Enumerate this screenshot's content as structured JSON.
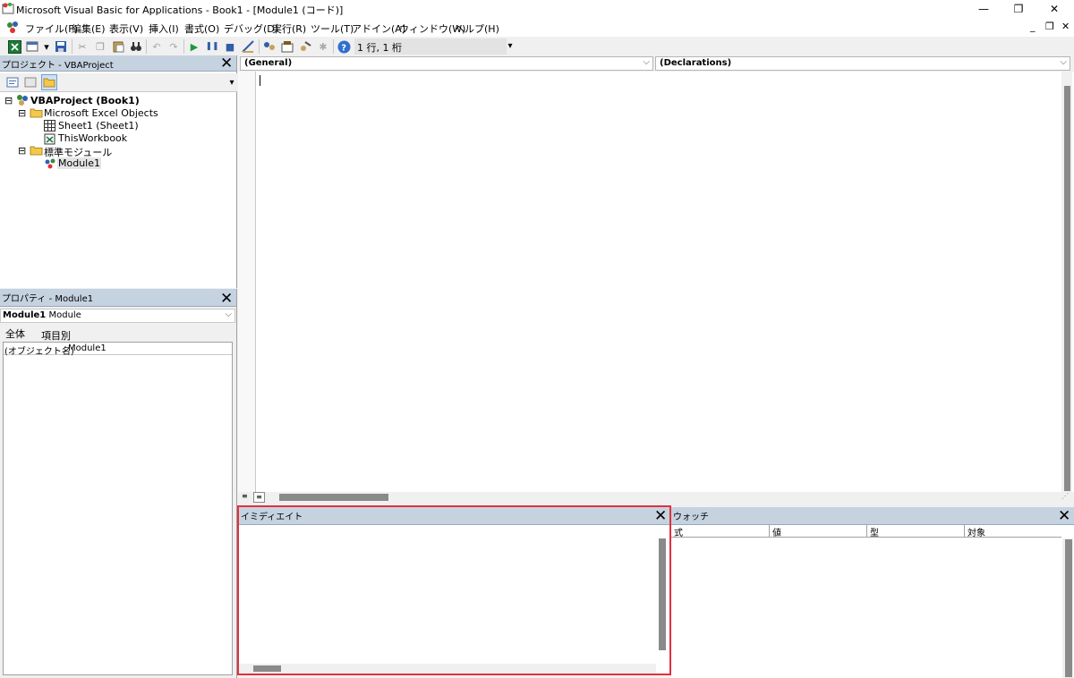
{
  "window": {
    "title": "Microsoft Visual Basic for Applications - Book1 - [Module1 (コード)]",
    "minimize": "—",
    "restore": "❐",
    "close": "✕"
  },
  "menu": {
    "items": [
      "ファイル(F)",
      "編集(E)",
      "表示(V)",
      "挿入(I)",
      "書式(O)",
      "デバッグ(D)",
      "実行(R)",
      "ツール(T)",
      "アドイン(A)",
      "ウィンドウ(W)",
      "ヘルプ(H)"
    ],
    "mdi_min": "_",
    "mdi_restore": "❐",
    "mdi_close": "✕"
  },
  "toolbar": {
    "position_label": "1 行, 1 桁"
  },
  "project": {
    "title": "プロジェクト - VBAProject",
    "root": "VBAProject (Book1)",
    "folder_objects": "Microsoft Excel Objects",
    "sheet1": "Sheet1 (Sheet1)",
    "thisworkbook": "ThisWorkbook",
    "folder_modules": "標準モジュール",
    "module1": "Module1"
  },
  "properties": {
    "title": "プロパティ - Module1",
    "object_name": "Module1",
    "object_type": "Module",
    "tab_all": "全体",
    "tab_category": "項目別",
    "row_name": "(オブジェクト名)",
    "row_value": "Module1"
  },
  "code": {
    "object_combo": "(General)",
    "proc_combo": "(Declarations)"
  },
  "immediate": {
    "title": "イミディエイト"
  },
  "watch": {
    "title": "ウォッチ",
    "columns": [
      "式",
      "値",
      "型",
      "対象"
    ]
  },
  "colors": {
    "panel_header": "#c5d2e0",
    "highlight_border": "#e0313c"
  }
}
